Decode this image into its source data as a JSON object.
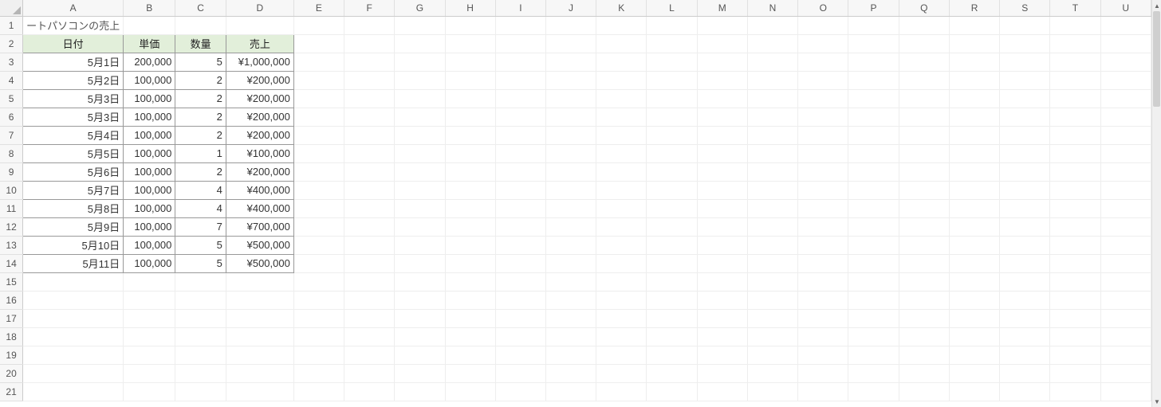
{
  "columns": [
    "A",
    "B",
    "C",
    "D",
    "E",
    "F",
    "G",
    "H",
    "I",
    "J",
    "K",
    "L",
    "M",
    "N",
    "O",
    "P",
    "Q",
    "R",
    "S",
    "T",
    "U"
  ],
  "visible_rows": 21,
  "sheet": {
    "title_cell": "ートパソコンの売上",
    "header": {
      "date": "日付",
      "unit_price": "単価",
      "qty": "数量",
      "sales": "売上"
    },
    "rows": [
      {
        "date": "5月1日",
        "unit_price": "200,000",
        "qty": "5",
        "sales": "¥1,000,000"
      },
      {
        "date": "5月2日",
        "unit_price": "100,000",
        "qty": "2",
        "sales": "¥200,000"
      },
      {
        "date": "5月3日",
        "unit_price": "100,000",
        "qty": "2",
        "sales": "¥200,000"
      },
      {
        "date": "5月3日",
        "unit_price": "100,000",
        "qty": "2",
        "sales": "¥200,000"
      },
      {
        "date": "5月4日",
        "unit_price": "100,000",
        "qty": "2",
        "sales": "¥200,000"
      },
      {
        "date": "5月5日",
        "unit_price": "100,000",
        "qty": "1",
        "sales": "¥100,000"
      },
      {
        "date": "5月6日",
        "unit_price": "100,000",
        "qty": "2",
        "sales": "¥200,000"
      },
      {
        "date": "5月7日",
        "unit_price": "100,000",
        "qty": "4",
        "sales": "¥400,000"
      },
      {
        "date": "5月8日",
        "unit_price": "100,000",
        "qty": "4",
        "sales": "¥400,000"
      },
      {
        "date": "5月9日",
        "unit_price": "100,000",
        "qty": "7",
        "sales": "¥700,000"
      },
      {
        "date": "5月10日",
        "unit_price": "100,000",
        "qty": "5",
        "sales": "¥500,000"
      },
      {
        "date": "5月11日",
        "unit_price": "100,000",
        "qty": "5",
        "sales": "¥500,000"
      }
    ]
  }
}
